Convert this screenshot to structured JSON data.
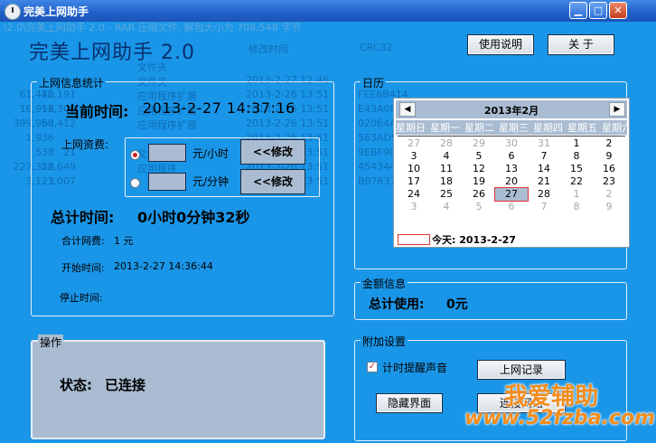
{
  "window": {
    "title": "完美上网助手"
  },
  "app_title": "完美上网助手 2.0",
  "ghost_text": {
    "filepath": "\\2.0\\完美上网助手 2.0 - RAR 压缩文件, 解包大小为 708,548 字节",
    "col_modified": "修改时间",
    "col_crc": "CRC32",
    "rows": [
      {
        "type": "文件夹",
        "time": "",
        "crc": "",
        "size": "",
        "packed": ""
      },
      {
        "type": "文件夹",
        "time": "2013-2-27 12:46",
        "crc": "",
        "size": "",
        "packed": ""
      },
      {
        "type": "应用程序扩展",
        "time": "2013-2-26 13:51",
        "crc": "FEE6B414",
        "size": "61,440",
        "packed": "12,191"
      },
      {
        "type": "应用程序扩展",
        "time": "2013-2-26 13:51",
        "crc": "E43A0BEC",
        "size": "16,958",
        "packed": "11,300"
      },
      {
        "type": "应用程序扩展",
        "time": "2013-2-26 13:51",
        "crc": "02064AEB",
        "size": "399,968",
        "packed": "58,412"
      },
      {
        "type": "",
        "time": "2013-2-26 13:51",
        "crc": "563AD979",
        "size": "1,936",
        "packed": ""
      },
      {
        "type": "文件",
        "time": "2013-2-26 13:51",
        "crc": "9EBF90F6",
        "size": "538",
        "packed": "21"
      },
      {
        "type": "应用程序",
        "time": "2013-2-26 13:51",
        "crc": "45434468",
        "size": "227,328",
        "packed": "52,649"
      },
      {
        "type": "",
        "time": "2013-2-26 13:51",
        "crc": "B0763703",
        "size": "3,123",
        "packed": "1,007"
      }
    ]
  },
  "toolbar": {
    "help_label": "使用说明",
    "about_label": "关 于"
  },
  "stats": {
    "group_label": "上网信息统计",
    "current_time_label": "当前时间:",
    "current_time_value": "2013-2-27 14:37:16",
    "fee_label": "上网资费:",
    "rate_per_hour_unit": "元/小时",
    "rate_per_minute_unit": "元/分钟",
    "modify_label": "<<修改",
    "total_time_label": "总计时间:",
    "total_time_value": "0小时0分钟32秒",
    "total_fee_label": "合计网费:",
    "total_fee_value": "1 元",
    "start_time_label": "开始时间:",
    "start_time_value": "2013-2-27 14:36:44",
    "stop_time_label": "停止时间:",
    "stop_time_value": ""
  },
  "calendar": {
    "group_label": "日历",
    "month_label": "2013年2月",
    "prev_icon": "◀",
    "next_icon": "▶",
    "weekdays": [
      "星期日",
      "星期一",
      "星期二",
      "星期三",
      "星期四",
      "星期五",
      "星期六"
    ],
    "days": [
      {
        "d": "27",
        "dim": true
      },
      {
        "d": "28",
        "dim": true
      },
      {
        "d": "29",
        "dim": true
      },
      {
        "d": "30",
        "dim": true
      },
      {
        "d": "31",
        "dim": true
      },
      {
        "d": "1",
        "dim": false
      },
      {
        "d": "2",
        "dim": false
      },
      {
        "d": "3",
        "dim": false
      },
      {
        "d": "4",
        "dim": false
      },
      {
        "d": "5",
        "dim": false
      },
      {
        "d": "6",
        "dim": false
      },
      {
        "d": "7",
        "dim": false
      },
      {
        "d": "8",
        "dim": false
      },
      {
        "d": "9",
        "dim": false
      },
      {
        "d": "10",
        "dim": false
      },
      {
        "d": "11",
        "dim": false
      },
      {
        "d": "12",
        "dim": false
      },
      {
        "d": "13",
        "dim": false
      },
      {
        "d": "14",
        "dim": false
      },
      {
        "d": "15",
        "dim": false
      },
      {
        "d": "16",
        "dim": false
      },
      {
        "d": "17",
        "dim": false
      },
      {
        "d": "18",
        "dim": false
      },
      {
        "d": "19",
        "dim": false
      },
      {
        "d": "20",
        "dim": false
      },
      {
        "d": "21",
        "dim": false
      },
      {
        "d": "22",
        "dim": false
      },
      {
        "d": "23",
        "dim": false
      },
      {
        "d": "24",
        "dim": false
      },
      {
        "d": "25",
        "dim": false
      },
      {
        "d": "26",
        "dim": false
      },
      {
        "d": "27",
        "dim": false,
        "selected": true
      },
      {
        "d": "28",
        "dim": false
      },
      {
        "d": "1",
        "dim": true
      },
      {
        "d": "2",
        "dim": true
      },
      {
        "d": "3",
        "dim": true
      },
      {
        "d": "4",
        "dim": true
      },
      {
        "d": "5",
        "dim": true
      },
      {
        "d": "6",
        "dim": true
      },
      {
        "d": "7",
        "dim": true
      },
      {
        "d": "8",
        "dim": true
      },
      {
        "d": "9",
        "dim": true
      }
    ],
    "today_label": "今天: 2013-2-27"
  },
  "amount": {
    "group_label": "金额信息",
    "total_used_label": "总计使用:",
    "total_used_value": "0元"
  },
  "operation": {
    "group_label": "操作",
    "status_label": "状态:",
    "status_value": "已连接"
  },
  "extra": {
    "group_label": "附加设置",
    "reminder_label": "计时提醒声音",
    "log_button": "上网记录",
    "hide_button": "隐藏界面",
    "connect_button": "连接网络"
  },
  "watermark": {
    "text": "我爱辅助",
    "url": "www.52fzba.com"
  },
  "colors": {
    "client_bg": "#1a96e8",
    "panel_gray": "#a9bcd2",
    "titlebar": "#1f5fc8",
    "watermark": "#f28c1c"
  }
}
